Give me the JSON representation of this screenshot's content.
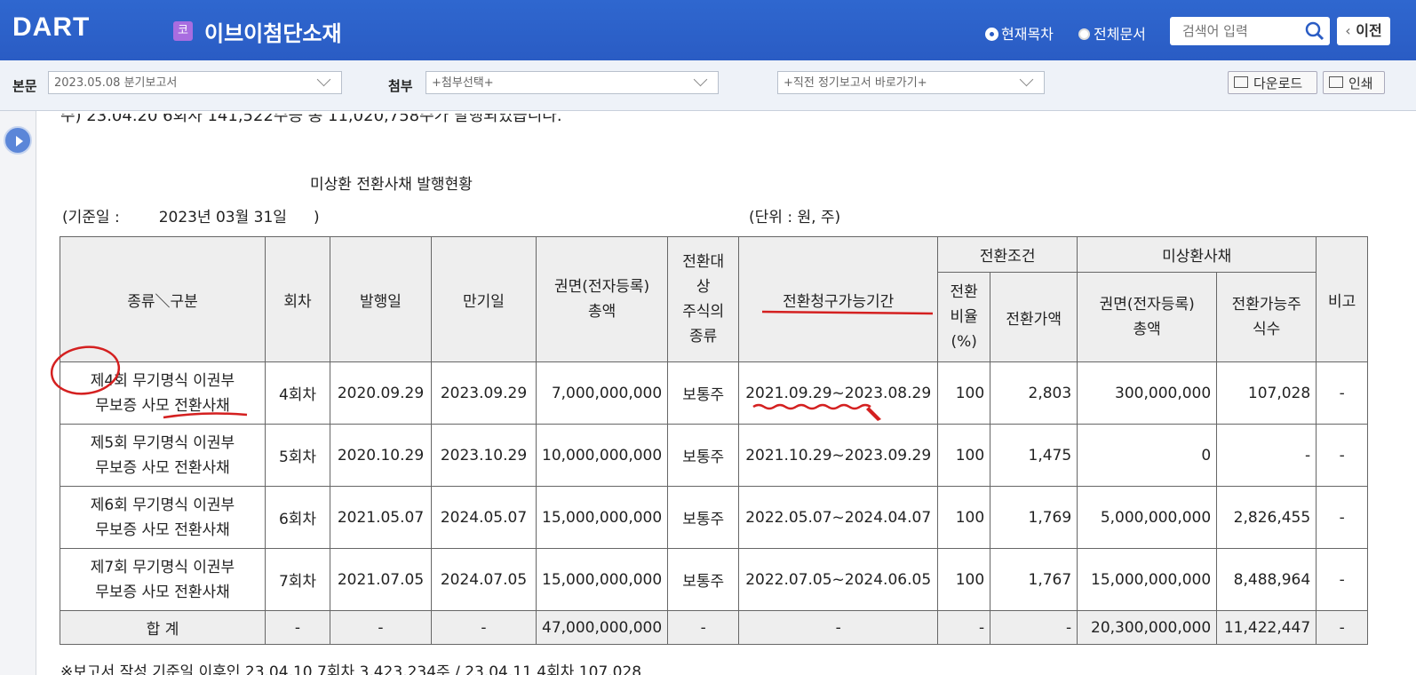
{
  "header": {
    "logo_text": "DART",
    "company_badge": "코",
    "company_name": "이브이첨단소재",
    "radio_current": "현재목차",
    "radio_all": "전체문서",
    "search_placeholder": "검색어 입력",
    "prev_button": "이전"
  },
  "toolbar": {
    "main_label": "본문",
    "main_select": "2023.05.08  분기보고서",
    "attach_label": "첨부",
    "attach_select": "+첨부선택+",
    "shortcut_select": "+직전 정기보고서 바로가기+",
    "download_button": "다운로드",
    "print_button": "인쇄"
  },
  "document": {
    "cut_line": "주) 23.04.20 6회차 141,522주등 총 11,020,758주가 발행되었습니다.",
    "table_title": "미상환 전환사채 발행현황",
    "basis_label": "(기준일 :",
    "basis_date": "2023년 03월 31일",
    "basis_close": ")",
    "unit": "(단위 : 원, 주)",
    "cut_bottom": "※보고서 작성 기준일 이후인 23.04.10  7회차 3,423,234주 / 23.04.11 4회차 107,028"
  },
  "table": {
    "headers": {
      "kind": "종류＼구분",
      "round": "회차",
      "issue_date": "발행일",
      "maturity": "만기일",
      "face_total_1": "권면(전자등록)",
      "face_total_2": "총액",
      "target_1": "전환대",
      "target_2": "상",
      "target_3": "주식의",
      "target_4": "종류",
      "period": "전환청구가능기간",
      "cond_group": "전환조건",
      "ratio_1": "전환",
      "ratio_2": "비율",
      "ratio_3": "(%)",
      "price": "전환가액",
      "unredeemed_group": "미상환사채",
      "uf_1": "권면(전자등록)",
      "uf_2": "총액",
      "shares_1": "전환가능주",
      "shares_2": "식수",
      "remark": "비고"
    },
    "rows": [
      {
        "kind_1": "제4회 무기명식 이권부",
        "kind_2": "무보증 사모 전환사채",
        "round": "4회차",
        "issue": "2020.09.29",
        "maturity": "2023.09.29",
        "face": "7,000,000,000",
        "target": "보통주",
        "period": "2021.09.29~2023.08.29",
        "ratio": "100",
        "price": "2,803",
        "unredeemed": "300,000,000",
        "shares": "107,028",
        "remark": "-"
      },
      {
        "kind_1": "제5회 무기명식 이권부",
        "kind_2": "무보증 사모 전환사채",
        "round": "5회차",
        "issue": "2020.10.29",
        "maturity": "2023.10.29",
        "face": "10,000,000,000",
        "target": "보통주",
        "period": "2021.10.29~2023.09.29",
        "ratio": "100",
        "price": "1,475",
        "unredeemed": "0",
        "shares": "-",
        "remark": "-"
      },
      {
        "kind_1": "제6회 무기명식 이권부",
        "kind_2": "무보증 사모 전환사채",
        "round": "6회차",
        "issue": "2021.05.07",
        "maturity": "2024.05.07",
        "face": "15,000,000,000",
        "target": "보통주",
        "period": "2022.05.07~2024.04.07",
        "ratio": "100",
        "price": "1,769",
        "unredeemed": "5,000,000,000",
        "shares": "2,826,455",
        "remark": "-"
      },
      {
        "kind_1": "제7회 무기명식 이권부",
        "kind_2": "무보증 사모 전환사채",
        "round": "7회차",
        "issue": "2021.07.05",
        "maturity": "2024.07.05",
        "face": "15,000,000,000",
        "target": "보통주",
        "period": "2022.07.05~2024.06.05",
        "ratio": "100",
        "price": "1,767",
        "unredeemed": "15,000,000,000",
        "shares": "8,488,964",
        "remark": "-"
      }
    ],
    "total": {
      "label": "합 계",
      "round": "-",
      "issue": "-",
      "maturity": "-",
      "face": "47,000,000,000",
      "target": "-",
      "period": "-",
      "ratio": "-",
      "price": "-",
      "unredeemed": "20,300,000,000",
      "shares": "11,422,447",
      "remark": "-"
    }
  },
  "colors": {
    "header_blue": "#2a5cc4",
    "annotation_red": "#d42020"
  }
}
